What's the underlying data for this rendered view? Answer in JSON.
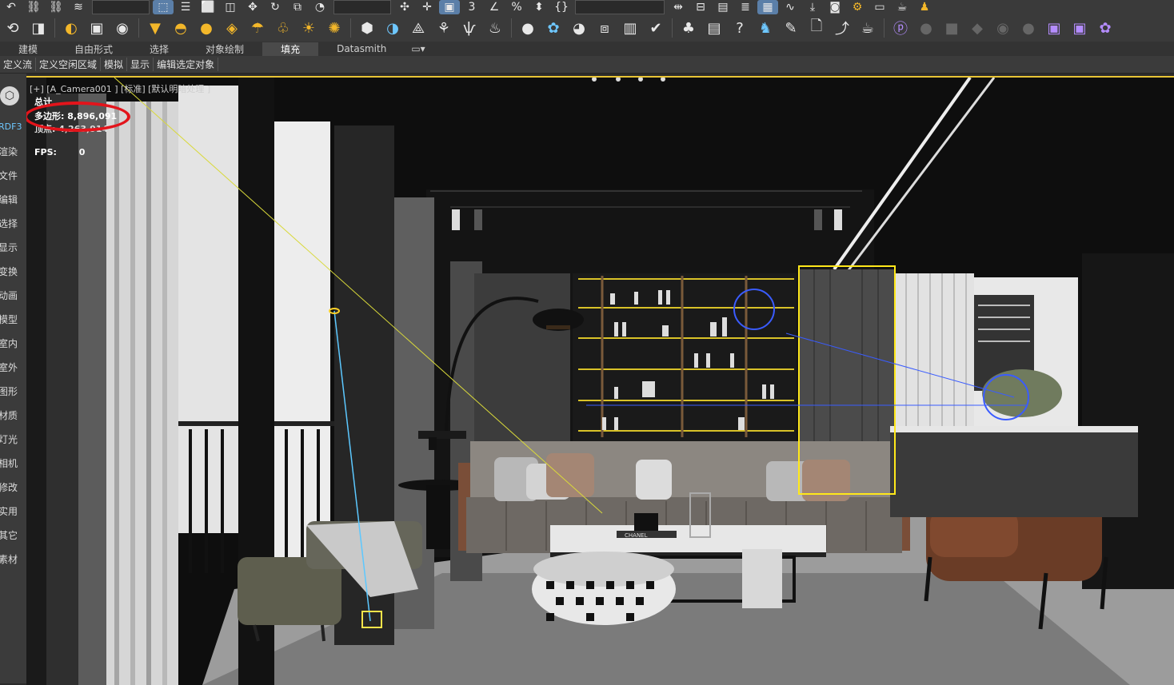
{
  "ribbon": {
    "tabs": [
      "建模",
      "自由形式",
      "选择",
      "对象绘制",
      "填充",
      "Datasmith"
    ],
    "active": "填充"
  },
  "submenu": [
    "定义流",
    "定义空闲区域",
    "模拟",
    "显示",
    "编辑选定对象"
  ],
  "left_panel": {
    "labels": [
      "RDF3",
      "渲染",
      "文件",
      "编辑",
      "选择",
      "显示",
      "变换",
      "动画",
      "模型",
      "室内",
      "室外",
      "图形",
      "材质",
      "灯光",
      "相机",
      "修改",
      "实用",
      "其它",
      "素材"
    ]
  },
  "viewport": {
    "label": "[+] [A_Camera001 ] [标准] [默认明暗处理 ]",
    "stats": {
      "total": "总计",
      "polygons": "多边形: 8,896,091",
      "vertices": "顶点: 4,263,914",
      "fps": "FPS:",
      "fps_value": "0"
    },
    "scene_text": {
      "book_label": "CHANEL"
    }
  }
}
